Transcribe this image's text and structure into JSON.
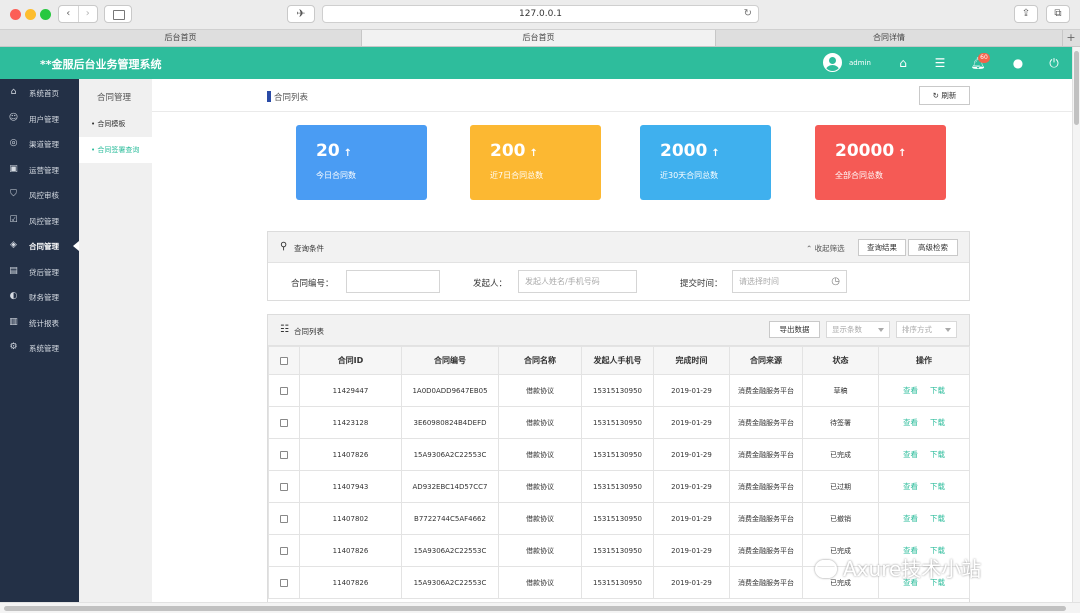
{
  "browser": {
    "url": "127.0.0.1",
    "tabs": [
      "后台首页",
      "后台首页",
      "合同详情"
    ],
    "active_tab": 1
  },
  "header": {
    "title": "**金服后台业务管理系统",
    "user": "admin",
    "notification_count": "60"
  },
  "sidebar": {
    "items": [
      {
        "label": "系统首页",
        "icon": "home-icon"
      },
      {
        "label": "用户管理",
        "icon": "user-icon"
      },
      {
        "label": "渠道管理",
        "icon": "channel-icon"
      },
      {
        "label": "运营管理",
        "icon": "box-icon"
      },
      {
        "label": "风控审核",
        "icon": "shield-icon"
      },
      {
        "label": "风控管理",
        "icon": "check-icon"
      },
      {
        "label": "合同管理",
        "icon": "tag-icon"
      },
      {
        "label": "贷后管理",
        "icon": "doc-icon"
      },
      {
        "label": "财务管理",
        "icon": "finance-icon"
      },
      {
        "label": "统计报表",
        "icon": "chart-icon"
      },
      {
        "label": "系统管理",
        "icon": "gear-icon"
      }
    ],
    "active_index": 6
  },
  "subsidebar": {
    "title": "合同管理",
    "items": [
      "• 合同模板",
      "• 合同签署查询"
    ],
    "active_index": 1
  },
  "breadcrumb": "合同列表",
  "refresh_label": "刷新",
  "stats": [
    {
      "value": "20",
      "label": "今日合同数",
      "color": "#4a9cf3"
    },
    {
      "value": "200",
      "label": "近7日合同总数",
      "color": "#fcb832"
    },
    {
      "value": "2000",
      "label": "近30天合同总数",
      "color": "#3fb0ee"
    },
    {
      "value": "20000",
      "label": "全部合同总数",
      "color": "#f55a55"
    }
  ],
  "query": {
    "title": "查询条件",
    "collapse_label": "收起筛选",
    "result_label": "查询结果",
    "advanced_label": "高级检索",
    "contract_no_label": "合同编号：",
    "contract_no_value": "",
    "initiator_label": "发起人：",
    "initiator_placeholder": "发起人姓名/手机号码",
    "time_label": "提交时间：",
    "time_placeholder": "请选择时间"
  },
  "list": {
    "title": "合同列表",
    "export_label": "导出数据",
    "page_size_placeholder": "显示条数",
    "sort_placeholder": "排序方式",
    "columns": [
      "合同ID",
      "合同编号",
      "合同名称",
      "发起人手机号",
      "完成时间",
      "合同来源",
      "状态",
      "操作"
    ],
    "rows": [
      {
        "id": "11429447",
        "no": "1A0D0ADD9647EB05",
        "name": "借款协议",
        "phone": "15315130950",
        "time": "2019-01-29",
        "source": "消费金融服务平台",
        "status": "草稿"
      },
      {
        "id": "11423128",
        "no": "3E60980824B4DEFD",
        "name": "借款协议",
        "phone": "15315130950",
        "time": "2019-01-29",
        "source": "消费金融服务平台",
        "status": "待签署"
      },
      {
        "id": "11407826",
        "no": "15A9306A2C22553C",
        "name": "借款协议",
        "phone": "15315130950",
        "time": "2019-01-29",
        "source": "消费金融服务平台",
        "status": "已完成"
      },
      {
        "id": "11407943",
        "no": "AD932EBC14D57CC7",
        "name": "借款协议",
        "phone": "15315130950",
        "time": "2019-01-29",
        "source": "消费金融服务平台",
        "status": "已过期"
      },
      {
        "id": "11407802",
        "no": "B7722744C5AF4662",
        "name": "借款协议",
        "phone": "15315130950",
        "time": "2019-01-29",
        "source": "消费金融服务平台",
        "status": "已撤销"
      },
      {
        "id": "11407826",
        "no": "15A9306A2C22553C",
        "name": "借款协议",
        "phone": "15315130950",
        "time": "2019-01-29",
        "source": "消费金融服务平台",
        "status": "已完成"
      },
      {
        "id": "11407826",
        "no": "15A9306A2C22553C",
        "name": "借款协议",
        "phone": "15315130950",
        "time": "2019-01-29",
        "source": "消费金融服务平台",
        "status": "已完成"
      }
    ],
    "view_label": "查看",
    "download_label": "下载"
  },
  "watermark": "Axure技术小站"
}
